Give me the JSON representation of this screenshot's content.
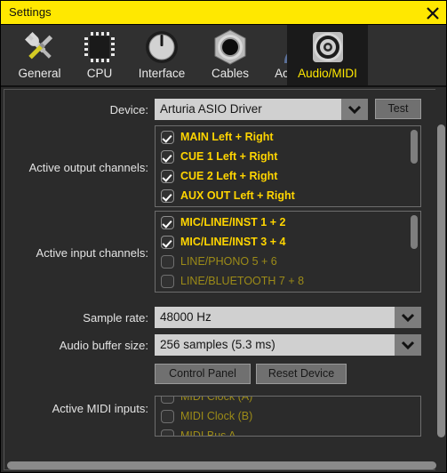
{
  "window": {
    "title": "Settings",
    "close_icon": "close-icon",
    "accent_color": "#ffe800"
  },
  "tabs": [
    {
      "label": "General",
      "icon": "wrench-screwdriver-icon",
      "selected": false
    },
    {
      "label": "CPU",
      "icon": "cpu-chip-icon",
      "selected": false
    },
    {
      "label": "Interface",
      "icon": "knob-icon",
      "selected": false
    },
    {
      "label": "Cables",
      "icon": "jack-connector-icon",
      "selected": false
    },
    {
      "label": "Account",
      "icon": "user-avatar-icon",
      "selected": false
    },
    {
      "label": "Audio/MIDI",
      "icon": "speaker-icon",
      "selected": true
    }
  ],
  "form": {
    "device": {
      "label": "Device:",
      "value": "Arturia ASIO Driver",
      "arrow_icon": "chevron-down-icon",
      "test_button": "Test"
    },
    "output_channels": {
      "label": "Active output channels:",
      "items": [
        {
          "label": "MAIN Left + Right",
          "checked": true
        },
        {
          "label": "CUE 1 Left + Right",
          "checked": true
        },
        {
          "label": "CUE 2 Left + Right",
          "checked": true
        },
        {
          "label": "AUX OUT Left + Right",
          "checked": true
        }
      ]
    },
    "input_channels": {
      "label": "Active input channels:",
      "items": [
        {
          "label": "MIC/LINE/INST 1 + 2",
          "checked": true
        },
        {
          "label": "MIC/LINE/INST 3 + 4",
          "checked": true
        },
        {
          "label": "LINE/PHONO 5 + 6",
          "checked": false
        },
        {
          "label": "LINE/BLUETOOTH 7 + 8",
          "checked": false
        }
      ]
    },
    "sample_rate": {
      "label": "Sample rate:",
      "value": "48000 Hz",
      "arrow_icon": "chevron-down-icon"
    },
    "buffer_size": {
      "label": "Audio buffer size:",
      "value": "256 samples (5.3 ms)",
      "arrow_icon": "chevron-down-icon"
    },
    "buttons": {
      "control_panel": "Control Panel",
      "reset_device": "Reset Device"
    },
    "midi_inputs": {
      "label": "Active MIDI inputs:",
      "items": [
        {
          "label": "MIDI Clock (A)",
          "checked": false
        },
        {
          "label": "MIDI Clock (B)",
          "checked": false
        },
        {
          "label": "MIDI Bus A",
          "checked": false
        }
      ]
    }
  }
}
